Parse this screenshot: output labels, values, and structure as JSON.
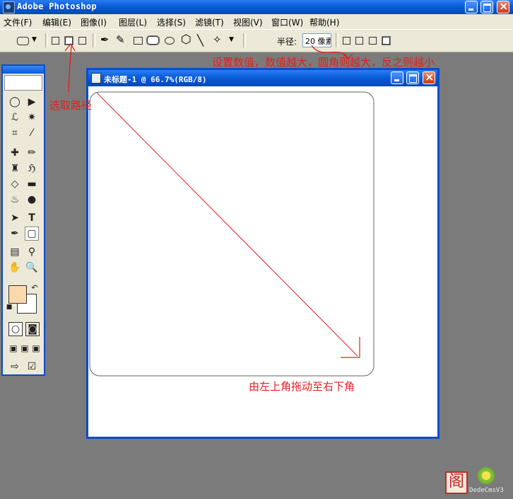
{
  "app": {
    "title": "Adobe Photoshop"
  },
  "menu": [
    {
      "label": "文件(F)"
    },
    {
      "label": "编辑(E)"
    },
    {
      "label": "图像(I)"
    },
    {
      "label": "图层(L)"
    },
    {
      "label": "选择(S)"
    },
    {
      "label": "滤镜(T)"
    },
    {
      "label": "视图(V)"
    },
    {
      "label": "窗口(W)"
    },
    {
      "label": "帮助(H)"
    }
  ],
  "options": {
    "radius_label": "半径:",
    "radius_value": "20 像素"
  },
  "toolbox": {
    "foreground_color": "#fcd9ac",
    "background_color": "#ffffff"
  },
  "document": {
    "title": "未标题-1 @ 66.7%(RGB/8)"
  },
  "annotations": {
    "radius_note": "设置数值，数值越大，圆角则越大，反之则越小",
    "path_note": "选取路径",
    "drag_note": "由左上角拖动至右下角",
    "color": "#e02020"
  },
  "watermark": {
    "text": "DedeCmsV3",
    "seal_char": "阁"
  }
}
